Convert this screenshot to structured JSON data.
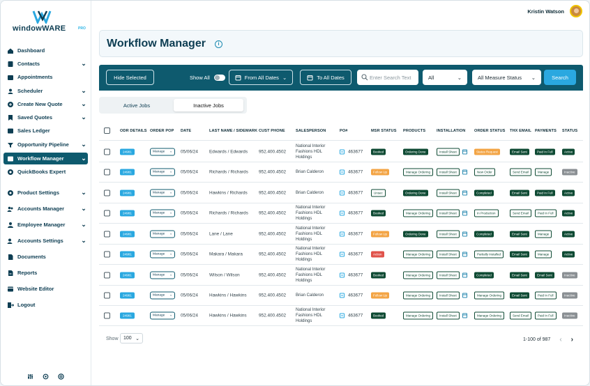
{
  "brand": {
    "name": "windowWARE",
    "pro": "PRO"
  },
  "user": {
    "name": "Kristin Watson"
  },
  "sidebar": {
    "items": [
      {
        "label": "Dashboard",
        "icon": "home-icon",
        "chev": ""
      },
      {
        "label": "Contacts",
        "icon": "contacts-icon",
        "chev": "⌄"
      },
      {
        "label": "Appointments",
        "icon": "calendar-icon",
        "chev": ""
      },
      {
        "label": "Scheduler",
        "icon": "user-icon",
        "chev": "⌄"
      },
      {
        "label": "Create New Quote",
        "icon": "plus-circle-icon",
        "chev": "⌄"
      },
      {
        "label": "Saved Quotes",
        "icon": "bookmark-icon",
        "chev": "⌄"
      },
      {
        "label": "Sales Ledger",
        "icon": "ledger-icon",
        "chev": ""
      },
      {
        "label": "Opportunity Pipeline",
        "icon": "pipeline-icon",
        "chev": "⌄"
      },
      {
        "label": "Workflow Manager",
        "icon": "workflow-icon",
        "chev": "⌄"
      },
      {
        "label": "QuickBooks Expert",
        "icon": "quickbooks-icon",
        "chev": ""
      },
      {
        "label": "Product Settings",
        "icon": "gear-icon",
        "chev": "⌄"
      },
      {
        "label": "Accounts Manager",
        "icon": "accounts-icon",
        "chev": "⌄"
      },
      {
        "label": "Employee Manager",
        "icon": "employees-icon",
        "chev": "⌄"
      },
      {
        "label": "Accounts Settings",
        "icon": "account-settings-icon",
        "chev": "⌄"
      },
      {
        "label": "Documents",
        "icon": "document-icon",
        "chev": ""
      },
      {
        "label": "Reports",
        "icon": "reports-icon",
        "chev": ""
      },
      {
        "label": "Website Editor",
        "icon": "website-icon",
        "chev": ""
      },
      {
        "label": "Logout",
        "icon": "logout-icon",
        "chev": ""
      }
    ]
  },
  "page": {
    "title": "Workflow Manager"
  },
  "filters": {
    "hide_selected": "Hide Selected",
    "show_all": "Show All",
    "from_dates": "From All Dates",
    "to_dates": "To All Dates",
    "search_placeholder": "Enter Search Text",
    "type_value": "All",
    "measure_status": "All Measure Status",
    "search_button": "Search"
  },
  "tabs": {
    "active": "Active Jobs",
    "inactive": "Inactive Jobs"
  },
  "table": {
    "headers": [
      "ODR DETAILS",
      "ORDER POP",
      "DATE",
      "LAST NAME / SIDEMARK",
      "CUST PHONE",
      "SALESPERSON",
      "PO#",
      "MSR STATUS",
      "PRODUCTS",
      "INSTALLATION",
      "ORDER STATUS",
      "THX EMAIL",
      "PAYMENTS",
      "STATUS"
    ],
    "rows": [
      {
        "odr": "24981",
        "pop": "Manage",
        "date": "05/06/24",
        "name": "Edwards / Edwards",
        "phone": "952.400.4502",
        "sp": "National Interior Fashions HDL Holdings",
        "po": "463677",
        "msr": "Booked",
        "msr_c": "b-dark",
        "prod": "Ordering Done",
        "prod_c": "b-dark",
        "inst": "Install Sheet",
        "ost": "Status Request",
        "ost_c": "b-orange",
        "thx": "Email Sent",
        "thx_c": "b-dark",
        "pay": "Paid In Full",
        "pay_c": "b-dark",
        "status": "Active",
        "status_c": "b-dark"
      },
      {
        "odr": "24981",
        "pop": "Manage",
        "date": "05/06/24",
        "name": "Richards / Richards",
        "phone": "952.400.4502",
        "sp": "Brian Calderon",
        "po": "463677",
        "msr": "Follow Up",
        "msr_c": "b-orange",
        "prod": "Manage Ordering",
        "prod_c": "b-out",
        "inst": "Install Sheet",
        "ost": "New Order",
        "ost_c": "b-out",
        "thx": "Send Email",
        "thx_c": "b-out",
        "pay": "Manage",
        "pay_c": "b-out",
        "status": "Inactive",
        "status_c": "b-gray"
      },
      {
        "odr": "24981",
        "pop": "Manage",
        "date": "05/06/24",
        "name": "Hawkins / Richards",
        "phone": "952.400.4502",
        "sp": "Brian Calderon",
        "po": "463677",
        "msr": "Unsec",
        "msr_c": "b-out",
        "prod": "Ordering Done",
        "prod_c": "b-dark",
        "inst": "Install Sheet",
        "ost": "Completed",
        "ost_c": "b-dark",
        "thx": "Email Sent",
        "thx_c": "b-dark",
        "pay": "Paid In Full",
        "pay_c": "b-dark",
        "status": "Active",
        "status_c": "b-dark"
      },
      {
        "odr": "24981",
        "pop": "Manage",
        "date": "05/06/24",
        "name": "Richards / Richards",
        "phone": "952.400.4502",
        "sp": "National Interior Fashions HDL Holdings",
        "po": "463677",
        "msr": "Booked",
        "msr_c": "b-dark",
        "prod": "Manage Ordering",
        "prod_c": "b-out",
        "inst": "Install Sheet",
        "ost": "In Production",
        "ost_c": "b-out",
        "thx": "Send Email",
        "thx_c": "b-out",
        "pay": "Paid In Full",
        "pay_c": "b-out",
        "status": "Active",
        "status_c": "b-dark"
      },
      {
        "odr": "24981",
        "pop": "Manage",
        "date": "05/06/24",
        "name": "Lane / Lane",
        "phone": "952.400.4502",
        "sp": "National Interior Fashions HDL Holdings",
        "po": "463677",
        "msr": "Follow Up",
        "msr_c": "b-orange",
        "prod": "Ordering Done",
        "prod_c": "b-dark",
        "inst": "Install Sheet",
        "ost": "Completed",
        "ost_c": "b-dark",
        "thx": "Email Sent",
        "thx_c": "b-dark",
        "pay": "Manage",
        "pay_c": "b-out",
        "status": "Active",
        "status_c": "b-dark"
      },
      {
        "odr": "24981",
        "pop": "Manage",
        "date": "05/06/24",
        "name": "Makara / Makara",
        "phone": "952.400.4502",
        "sp": "National Interior Fashions HDL Holdings",
        "po": "463677",
        "msr": "Action",
        "msr_c": "b-red",
        "prod": "Manage Ordering",
        "prod_c": "b-out",
        "inst": "Install Sheet",
        "ost": "Partially Installed",
        "ost_c": "b-out",
        "thx": "Email Sent",
        "thx_c": "b-dark",
        "pay": "Manage",
        "pay_c": "b-out",
        "status": "Active",
        "status_c": "b-dark"
      },
      {
        "odr": "24981",
        "pop": "Manage",
        "date": "05/06/24",
        "name": "Wilson / Wilson",
        "phone": "952.400.4502",
        "sp": "National Interior Fashions HDL Holdings",
        "po": "463677",
        "msr": "Booked",
        "msr_c": "b-dark",
        "prod": "Manage Ordering",
        "prod_c": "b-out",
        "inst": "Install Sheet",
        "ost": "Completed",
        "ost_c": "b-dark",
        "thx": "Email Sent",
        "thx_c": "b-dark",
        "pay": "Email Sent",
        "pay_c": "b-dark",
        "status": "Inactive",
        "status_c": "b-gray"
      },
      {
        "odr": "24981",
        "pop": "Manage",
        "date": "05/06/24",
        "name": "Hawkins / Hawkins",
        "phone": "952.400.4502",
        "sp": "Brian Calderon",
        "po": "463677",
        "msr": "Follow Up",
        "msr_c": "b-orange",
        "prod": "Manage Ordering",
        "prod_c": "b-out",
        "inst": "Install Sheet",
        "ost": "Manage Ordering",
        "ost_c": "b-out",
        "thx": "Email Sent",
        "thx_c": "b-dark",
        "pay": "Paid In Full",
        "pay_c": "b-out",
        "status": "Inactive",
        "status_c": "b-gray"
      },
      {
        "odr": "24981",
        "pop": "Manage",
        "date": "05/06/24",
        "name": "Hawkins / Hawkins",
        "phone": "952.400.4502",
        "sp": "National Interior Fashions HDL Holdings",
        "po": "463677",
        "msr": "Booked",
        "msr_c": "b-dark",
        "prod": "Manage Ordering",
        "prod_c": "b-out",
        "inst": "Install Sheet",
        "ost": "Manage Ordering",
        "ost_c": "b-out",
        "thx": "Send Email",
        "thx_c": "b-out",
        "pay": "Paid In Full",
        "pay_c": "b-out",
        "status": "Inactive",
        "status_c": "b-gray"
      }
    ]
  },
  "footer": {
    "show_label": "Show",
    "page_size": "100",
    "range": "1-100 of 987"
  },
  "colors": {
    "primary": "#0e5a6e",
    "accent": "#2aa8e0",
    "dark_badge": "#0e4a33",
    "orange": "#f3a444"
  }
}
